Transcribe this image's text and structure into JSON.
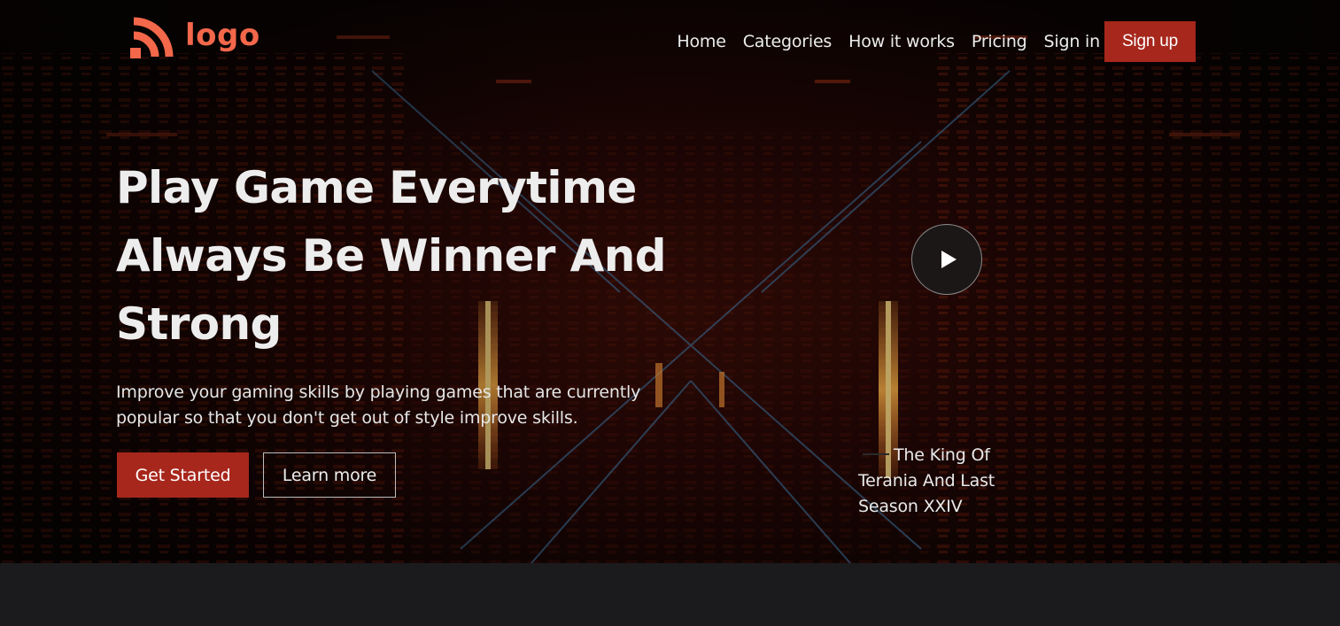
{
  "logo": {
    "text": "logo",
    "icon": "rss-arcs-icon",
    "color": "#f3674a"
  },
  "nav": {
    "links": [
      "Home",
      "Categories",
      "How it works",
      "Pricing",
      "Sign in"
    ],
    "signup_label": "Sign up"
  },
  "hero": {
    "headline_lines": [
      "Play Game Everytime",
      "Always Be Winner And",
      "Strong"
    ],
    "subtext": "Improve your gaming skills by playing games that are currently popular so that you don't get out of style improve skills.",
    "primary_button": "Get Started",
    "secondary_button": "Learn more",
    "play_icon": "play-icon",
    "caption": "The King Of Terania And Last Season XXIV"
  },
  "colors": {
    "accent": "#a7271c",
    "logo": "#f3674a",
    "text": "#ededed",
    "bottom_band": "#1b1b1d"
  }
}
